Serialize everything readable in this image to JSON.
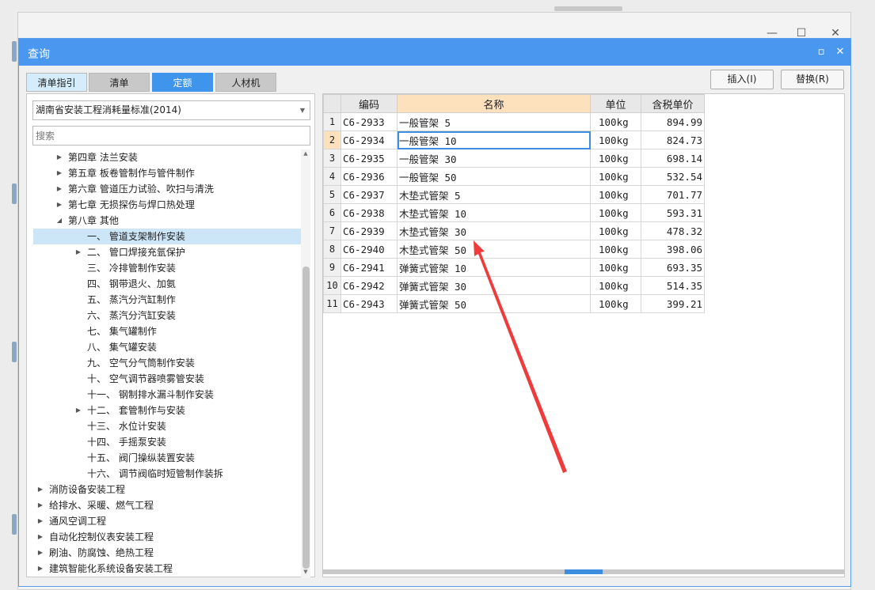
{
  "window": {
    "minimize": "—",
    "maximize": "☐",
    "close": "✕"
  },
  "dialog": {
    "title": "查询",
    "restore": "▫",
    "close": "✕"
  },
  "tabs": [
    "清单指引",
    "清单",
    "定额",
    "人材机"
  ],
  "buttons": {
    "insert": "插入(I)",
    "replace": "替换(R)"
  },
  "combo": {
    "value": "湖南省安装工程消耗量标准(2014)"
  },
  "search": {
    "placeholder": "搜索"
  },
  "tree": [
    {
      "label": "第四章 法兰安装",
      "level": 1,
      "toggle": "collapsed"
    },
    {
      "label": "第五章 板卷管制作与管件制作",
      "level": 1,
      "toggle": "collapsed"
    },
    {
      "label": "第六章 管道压力试验、吹扫与清洗",
      "level": 1,
      "toggle": "collapsed"
    },
    {
      "label": "第七章 无损探伤与焊口热处理",
      "level": 1,
      "toggle": "collapsed"
    },
    {
      "label": "第八章 其他",
      "level": 1,
      "toggle": "expanded"
    },
    {
      "label": "一、 管道支架制作安装",
      "level": 2,
      "toggle": "none",
      "selected": true
    },
    {
      "label": "二、 管口焊接充氩保护",
      "level": 2,
      "toggle": "collapsed"
    },
    {
      "label": "三、 冷排管制作安装",
      "level": 2,
      "toggle": "none"
    },
    {
      "label": "四、 钢带退火、加氨",
      "level": 2,
      "toggle": "none"
    },
    {
      "label": "五、 蒸汽分汽缸制作",
      "level": 2,
      "toggle": "none"
    },
    {
      "label": "六、 蒸汽分汽缸安装",
      "level": 2,
      "toggle": "none"
    },
    {
      "label": "七、 集气罐制作",
      "level": 2,
      "toggle": "none"
    },
    {
      "label": "八、 集气罐安装",
      "level": 2,
      "toggle": "none"
    },
    {
      "label": "九、 空气分气筒制作安装",
      "level": 2,
      "toggle": "none"
    },
    {
      "label": "十、 空气调节器喷雾管安装",
      "level": 2,
      "toggle": "none"
    },
    {
      "label": "十一、 钢制排水漏斗制作安装",
      "level": 2,
      "toggle": "none"
    },
    {
      "label": "十二、 套管制作与安装",
      "level": 2,
      "toggle": "collapsed"
    },
    {
      "label": "十三、 水位计安装",
      "level": 2,
      "toggle": "none"
    },
    {
      "label": "十四、 手摇泵安装",
      "level": 2,
      "toggle": "none"
    },
    {
      "label": "十五、 阀门操纵装置安装",
      "level": 2,
      "toggle": "none"
    },
    {
      "label": "十六、 调节阀临时短管制作装拆",
      "level": 2,
      "toggle": "none"
    },
    {
      "label": "消防设备安装工程",
      "level": 0,
      "toggle": "collapsed"
    },
    {
      "label": "给排水、采暖、燃气工程",
      "level": 0,
      "toggle": "collapsed"
    },
    {
      "label": "通风空调工程",
      "level": 0,
      "toggle": "collapsed"
    },
    {
      "label": "自动化控制仪表安装工程",
      "level": 0,
      "toggle": "collapsed"
    },
    {
      "label": "刷油、防腐蚀、绝热工程",
      "level": 0,
      "toggle": "collapsed"
    },
    {
      "label": "建筑智能化系统设备安装工程",
      "level": 0,
      "toggle": "collapsed"
    }
  ],
  "table": {
    "headers": [
      "编码",
      "名称",
      "单位",
      "含税单价"
    ],
    "rows": [
      {
        "no": "1",
        "code": "C6-2933",
        "name": "一般管架 5",
        "unit": "100kg",
        "price": "894.99"
      },
      {
        "no": "2",
        "code": "C6-2934",
        "name": "一般管架 10",
        "unit": "100kg",
        "price": "824.73"
      },
      {
        "no": "3",
        "code": "C6-2935",
        "name": "一般管架 30",
        "unit": "100kg",
        "price": "698.14"
      },
      {
        "no": "4",
        "code": "C6-2936",
        "name": "一般管架 50",
        "unit": "100kg",
        "price": "532.54"
      },
      {
        "no": "5",
        "code": "C6-2937",
        "name": "木垫式管架 5",
        "unit": "100kg",
        "price": "701.77"
      },
      {
        "no": "6",
        "code": "C6-2938",
        "name": "木垫式管架 10",
        "unit": "100kg",
        "price": "593.31"
      },
      {
        "no": "7",
        "code": "C6-2939",
        "name": "木垫式管架 30",
        "unit": "100kg",
        "price": "478.32"
      },
      {
        "no": "8",
        "code": "C6-2940",
        "name": "木垫式管架 50",
        "unit": "100kg",
        "price": "398.06"
      },
      {
        "no": "9",
        "code": "C6-2941",
        "name": "弹簧式管架 10",
        "unit": "100kg",
        "price": "693.35"
      },
      {
        "no": "10",
        "code": "C6-2942",
        "name": "弹簧式管架 30",
        "unit": "100kg",
        "price": "514.35"
      },
      {
        "no": "11",
        "code": "C6-2943",
        "name": "弹簧式管架 50",
        "unit": "100kg",
        "price": "399.21"
      }
    ],
    "current_row": 2
  },
  "colors": {
    "accent": "#4a97f0",
    "header_highlight": "#fde1bd",
    "selection": "#cde6f7",
    "annotation_arrow": "#ee3b3b"
  }
}
